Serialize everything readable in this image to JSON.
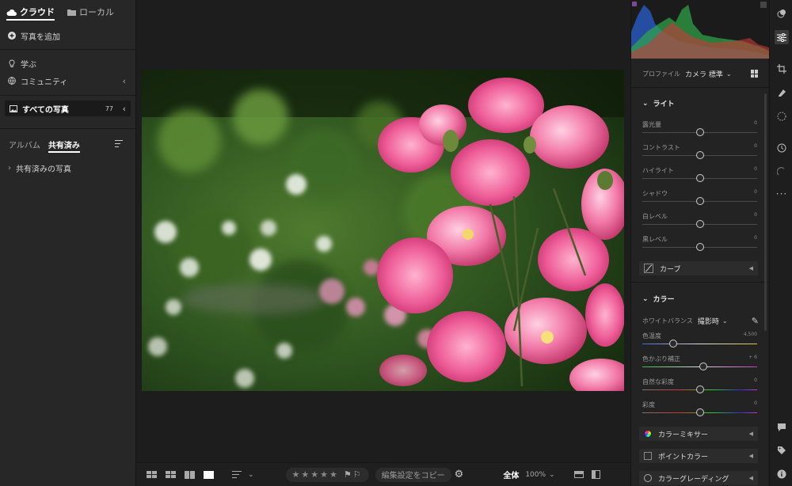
{
  "left": {
    "tabs": [
      {
        "label": "クラウド",
        "icon": "cloud-icon",
        "active": true
      },
      {
        "label": "ローカル",
        "icon": "folder-icon",
        "active": false
      }
    ],
    "add_photos": "写真を追加",
    "learn": "学ぶ",
    "community": "コミュニティ",
    "all_photos": {
      "label": "すべての写真",
      "count": "77"
    },
    "subtabs": [
      {
        "label": "アルバム",
        "active": false
      },
      {
        "label": "共有済み",
        "active": true
      }
    ],
    "shared_photos": "共有済みの写真"
  },
  "bottombar": {
    "stars": [
      "★",
      "★",
      "★",
      "★",
      "★"
    ],
    "copy_settings": "編集設定をコピー",
    "view_label": "全体",
    "zoom": "100%"
  },
  "right": {
    "profile_label": "プロファイル",
    "profile_value": "カメラ 標準",
    "light_title": "ライト",
    "light_sliders": [
      {
        "label": "露光量",
        "value": "0",
        "pos": 0.5
      },
      {
        "label": "コントラスト",
        "value": "0",
        "pos": 0.5
      },
      {
        "label": "ハイライト",
        "value": "0",
        "pos": 0.5
      },
      {
        "label": "シャドウ",
        "value": "0",
        "pos": 0.5
      },
      {
        "label": "白レベル",
        "value": "0",
        "pos": 0.5
      },
      {
        "label": "黒レベル",
        "value": "0",
        "pos": 0.5
      }
    ],
    "curve_label": "カーブ",
    "color_title": "カラー",
    "wb_label": "ホワイトバランス",
    "wb_value": "撮影時",
    "color_sliders": [
      {
        "label": "色温度",
        "value": "4,500",
        "pos": 0.27,
        "type": "temp"
      },
      {
        "label": "色かぶり補正",
        "value": "+ 6",
        "pos": 0.53,
        "type": "tint"
      },
      {
        "label": "自然な彩度",
        "value": "0",
        "pos": 0.5,
        "type": "sat"
      },
      {
        "label": "彩度",
        "value": "0",
        "pos": 0.5,
        "type": "sat"
      }
    ],
    "color_mixer": "カラーミキサー",
    "point_color": "ポイントカラー",
    "color_grading": "カラーグレーディング"
  },
  "colors": {
    "accent": "#ffffff",
    "panel": "#232323",
    "histogram_blue": "#2a5fd0",
    "histogram_green": "#2fa84a",
    "histogram_red": "#c93838"
  }
}
